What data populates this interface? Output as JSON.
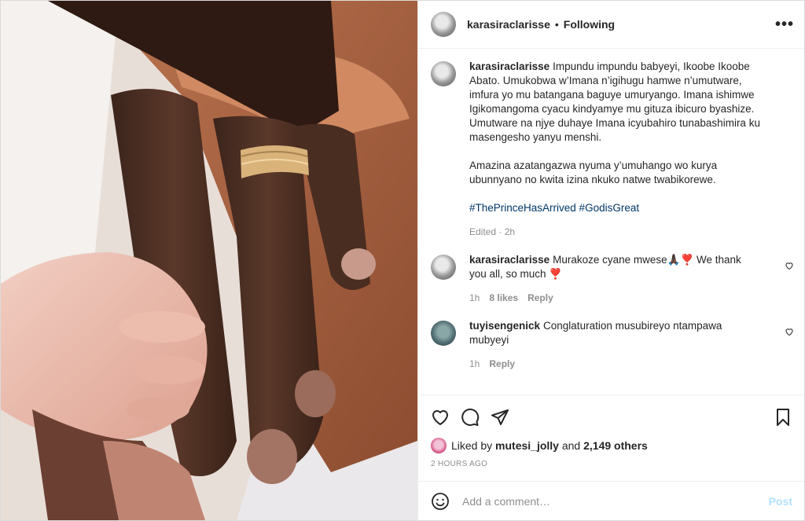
{
  "header": {
    "username": "karasiraclarisse",
    "dot": "•",
    "follow_status": "Following",
    "more": "•••"
  },
  "caption": {
    "username": "karasiraclarisse",
    "text": "Impundu impundu babyeyi, Ikoobe Ikoobe Abato. Umukobwa w’Imana n’igihugu hamwe n’umutware, imfura yo mu batangana baguye umuryango. Imana ishimwe Igikomangoma cyacu kindyamye mu gituza ibicuro byashize. Umutware na njye duhaye Imana icyubahiro tunabashimira ku masengesho yanyu menshi.",
    "text2": "Amazina azatangazwa nyuma y’umuhango wo kurya ubunnyano no kwita izina nkuko natwe twabikorewe.",
    "hashtags": "#ThePrinceHasArrived #GodisGreat",
    "edited": "Edited · 2h"
  },
  "comments": [
    {
      "username": "karasiraclarisse",
      "text": "Murakoze cyane mwese🙏🏿❣️ We thank you all, so much ❣️",
      "time": "1h",
      "likes": "8 likes",
      "reply": "Reply"
    },
    {
      "username": "tuyisengenick",
      "text": "Conglaturation musubireyo ntampawa mubyeyi",
      "time": "1h",
      "reply": "Reply"
    }
  ],
  "likes": {
    "prefix": "Liked by",
    "user": "mutesi_jolly",
    "and": "and",
    "others": "2,149 others"
  },
  "timestamp": "2 HOURS AGO",
  "add_comment": {
    "placeholder": "Add a comment…",
    "post_label": "Post"
  },
  "colors": {
    "hashtag": "#00376b",
    "post_disabled": "#b2dffc",
    "muted": "#8e8e8e"
  }
}
